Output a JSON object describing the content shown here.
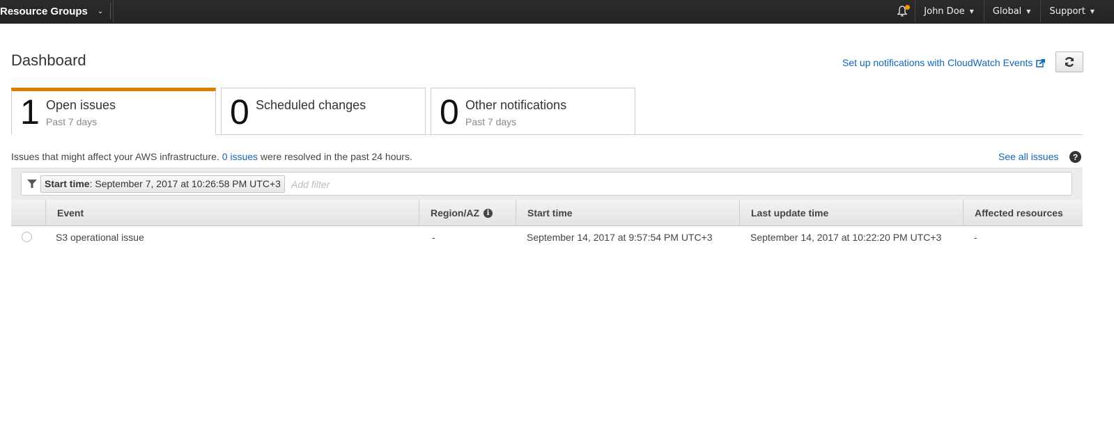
{
  "topnav": {
    "service_menu": "Resource Groups",
    "notifications_has_alert": true,
    "user": "John Doe",
    "region": "Global",
    "support": "Support",
    "colors": {
      "bar": "#232323",
      "alert_dot": "#f49a0a"
    }
  },
  "header": {
    "title": "Dashboard",
    "cloudwatch_link": "Set up notifications with CloudWatch Events",
    "refresh_icon": "refresh-icon"
  },
  "tabs": [
    {
      "count": "1",
      "title": "Open issues",
      "subtitle": "Past 7 days",
      "active": true
    },
    {
      "count": "0",
      "title": "Scheduled changes",
      "subtitle": "",
      "active": false
    },
    {
      "count": "0",
      "title": "Other notifications",
      "subtitle": "Past 7 days",
      "active": false
    }
  ],
  "info": {
    "prefix": "Issues that might affect your AWS infrastructure. ",
    "link": "0 issues",
    "suffix": " were resolved in the past 24 hours.",
    "see_all": "See all issues",
    "help": "?"
  },
  "filter": {
    "token_key": "Start time",
    "token_value": ": September 7, 2017 at 10:26:58 PM UTC+3",
    "placeholder": "Add filter"
  },
  "table": {
    "columns": [
      "Event",
      "Region/AZ",
      "Start time",
      "Last update time",
      "Affected resources"
    ],
    "rows": [
      {
        "selected": false,
        "event": "S3 operational issue",
        "region": "-",
        "start_time": "September 14, 2017 at 9:57:54 PM UTC+3",
        "last_update": "September 14, 2017 at 10:22:20 PM UTC+3",
        "affected": "-"
      }
    ]
  },
  "colors": {
    "accent": "#e07b00",
    "link": "#1166bb"
  }
}
